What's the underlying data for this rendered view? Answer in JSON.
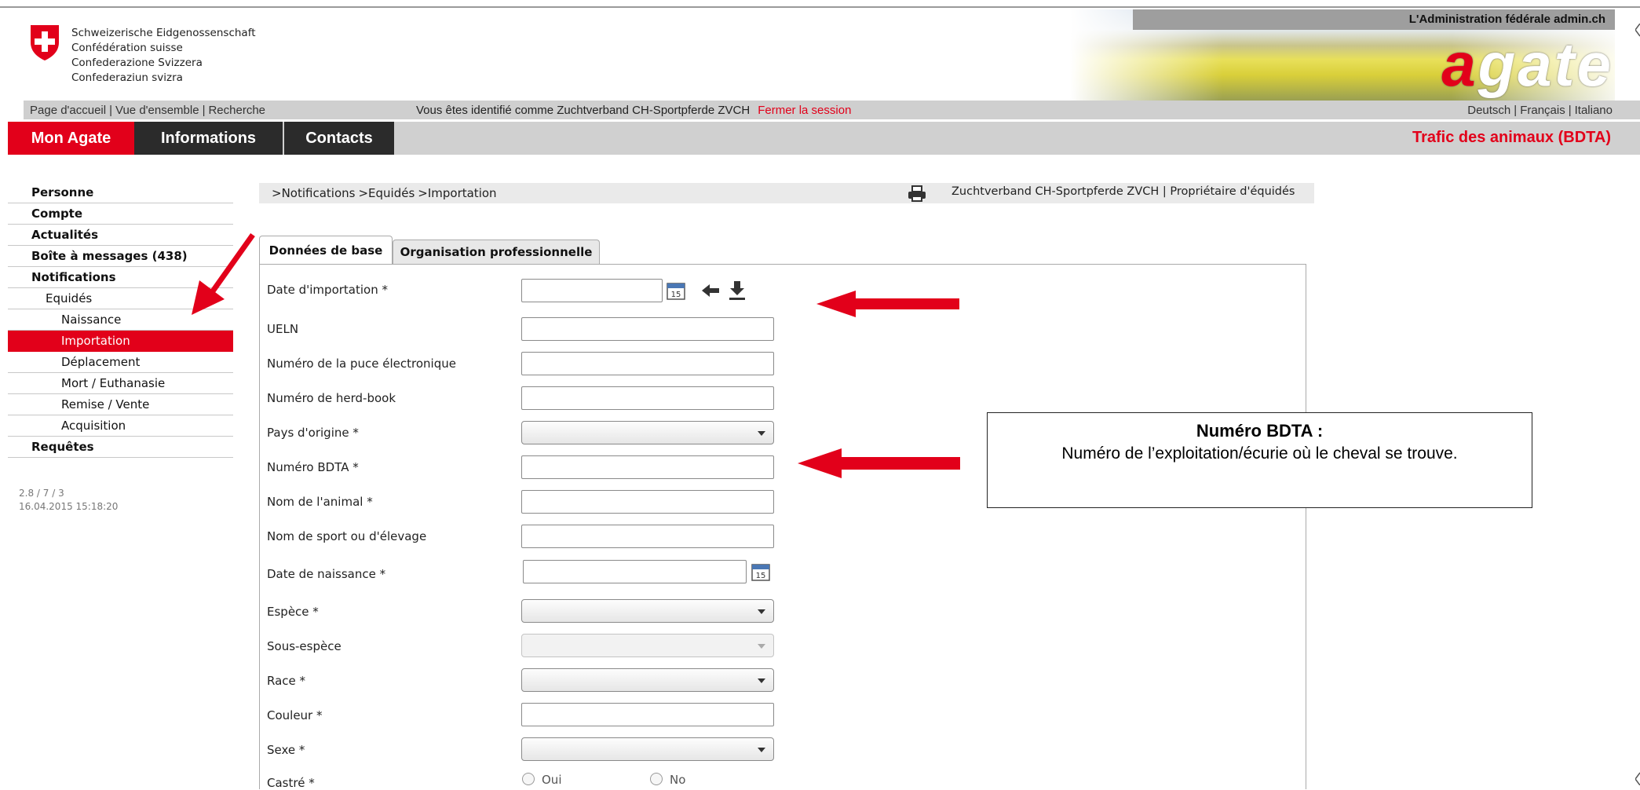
{
  "header": {
    "confederation": [
      "Schweizerische Eidgenossenschaft",
      "Confédération suisse",
      "Confederazione Svizzera",
      "Confederaziun svizra"
    ],
    "admin_label": "L'Administration fédérale admin.ch",
    "logo_a": "a",
    "logo_rest": "gate"
  },
  "top_nav": {
    "home": "Page d'accueil",
    "overview": "Vue d'ensemble",
    "search": "Recherche",
    "identified": "Vous êtes identifié comme Zuchtverband CH-Sportpferde ZVCH",
    "logout": "Fermer la session",
    "languages": [
      "Deutsch",
      "Français",
      "Italiano"
    ]
  },
  "tabs": {
    "mon_agate": "Mon Agate",
    "informations": "Informations",
    "contacts": "Contacts",
    "trafic": "Trafic des animaux (BDTA)"
  },
  "sidebar": {
    "items": [
      {
        "label": "Personne"
      },
      {
        "label": "Compte"
      },
      {
        "label": "Actualités"
      },
      {
        "label": "Boîte à messages (438)"
      },
      {
        "label": "Notifications"
      },
      {
        "label": "Equidés"
      },
      {
        "label": "Naissance"
      },
      {
        "label": "Importation"
      },
      {
        "label": "Déplacement"
      },
      {
        "label": "Mort / Euthanasie"
      },
      {
        "label": "Remise / Vente"
      },
      {
        "label": "Acquisition"
      },
      {
        "label": "Requêtes"
      }
    ],
    "version": "2.8 / 7 / 3",
    "timestamp": "16.04.2015 15:18:20"
  },
  "breadcrumb": {
    "items": [
      ">Notifications",
      ">Equidés",
      ">Importation"
    ],
    "user": "Zuchtverband CH-Sportpferde ZVCH | Propriétaire d'équidés"
  },
  "form": {
    "tab_base": "Données de base",
    "tab_org": "Organisation professionnelle",
    "labels": {
      "import_date": "Date d'importation *",
      "ueln": "UELN",
      "chip": "Numéro de la puce électronique",
      "herdbook": "Numéro de herd-book",
      "origin": "Pays d'origine *",
      "bdta": "Numéro BDTA *",
      "animal_name": "Nom de l'animal *",
      "sport_name": "Nom de sport ou d'élevage",
      "birth_date": "Date de naissance *",
      "species": "Espèce *",
      "subspecies": "Sous-espèce",
      "race": "Race *",
      "color": "Couleur *",
      "sex": "Sexe *",
      "castrated": "Castré *"
    },
    "calendar_day": "15",
    "radio_yes": "Oui",
    "radio_no": "No"
  },
  "annotation": {
    "title": "Numéro BDTA :",
    "text": "Numéro de l’exploitation/écurie où le cheval se trouve."
  },
  "colors": {
    "accent": "#e2001a",
    "dark_tab": "#2b2b2b",
    "grey_bar": "#d0d0d0"
  }
}
